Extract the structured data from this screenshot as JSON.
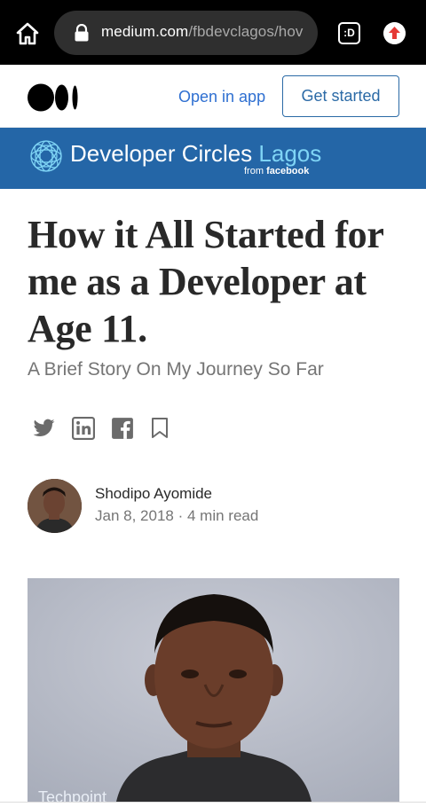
{
  "browser": {
    "url_domain": "medium.com",
    "url_path": "/fbdevclagos/hov",
    "tabs_label": ":D"
  },
  "header": {
    "logo_icon": "medium-logo-icon",
    "open_in_app": "Open in app",
    "get_started": "Get started"
  },
  "publication": {
    "name_main": "Developer Circles",
    "name_accent": "Lagos",
    "from_prefix": "from",
    "from_brand": "facebook",
    "colors": {
      "banner": "#2466a7",
      "accent": "#7fd4f5"
    }
  },
  "article": {
    "title": "How it All Started for me as a Developer at Age 11.",
    "subtitle": "A Brief Story On My Journey So Far",
    "author": "Shodipo Ayomide",
    "date": "Jan 8, 2018",
    "separator": "·",
    "read_time": "4 min read",
    "image_watermark": "Techpoint"
  },
  "share_icons": [
    "twitter-icon",
    "linkedin-icon",
    "facebook-icon",
    "bookmark-icon"
  ]
}
